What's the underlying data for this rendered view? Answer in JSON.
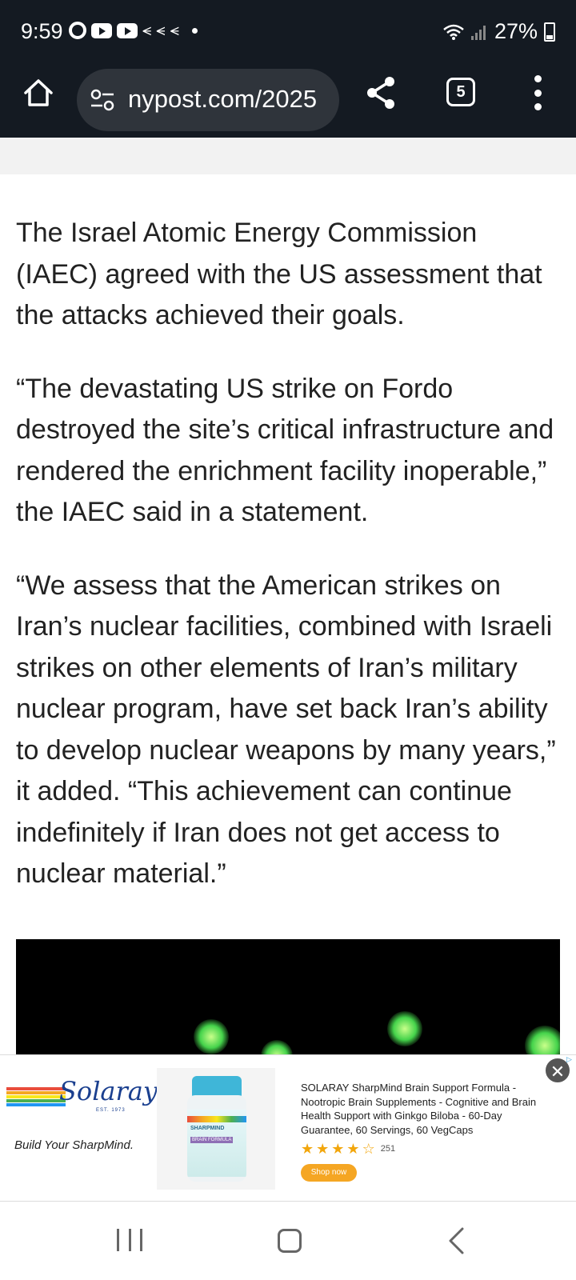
{
  "status_bar": {
    "time": "9:59",
    "battery": "27%"
  },
  "browser": {
    "url": "nypost.com/2025",
    "tab_count": "5"
  },
  "article": {
    "paragraphs": [
      "The Israel Atomic Energy Commission (IAEC) agreed with the US assessment that the attacks achieved their goals.",
      "“The devastating US strike on Fordo destroyed the site’s critical infrastructure and rendered the enrichment facility inoperable,” the IAEC said in a statement.",
      "“We assess that the American strikes on Iran’s nuclear facilities, combined with Israeli strikes on other elements of Iran’s military nuclear program, have set back Iran’s ability to develop nuclear weapons by many years,” it added. “This achievement can continue indefinitely if Iran does not get access to nuclear material.”"
    ]
  },
  "ad": {
    "brand": "Solaray",
    "brand_est": "EST. 1973",
    "tagline": "Build Your SharpMind.",
    "product_label_1": "SHARPMIND",
    "product_label_2": "BRAIN FORMULA",
    "description": "SOLARAY SharpMind Brain Support Formula - Nootropic Brain Supplements - Cognitive and Brain Health Support with Ginkgo Biloba - 60-Day Guarantee, 60 Servings, 60 VegCaps",
    "rating": 4.5,
    "review_count": "251",
    "cta": "Shop now",
    "close_glyph": "✕",
    "choices_glyph": "▷"
  },
  "icons": {
    "home": "home-icon",
    "site_info": "tune-icon",
    "share": "share-icon",
    "menu": "more-vert-icon",
    "nav_recent": "recent-apps-icon",
    "nav_home": "home-button-icon",
    "nav_back": "back-icon"
  }
}
